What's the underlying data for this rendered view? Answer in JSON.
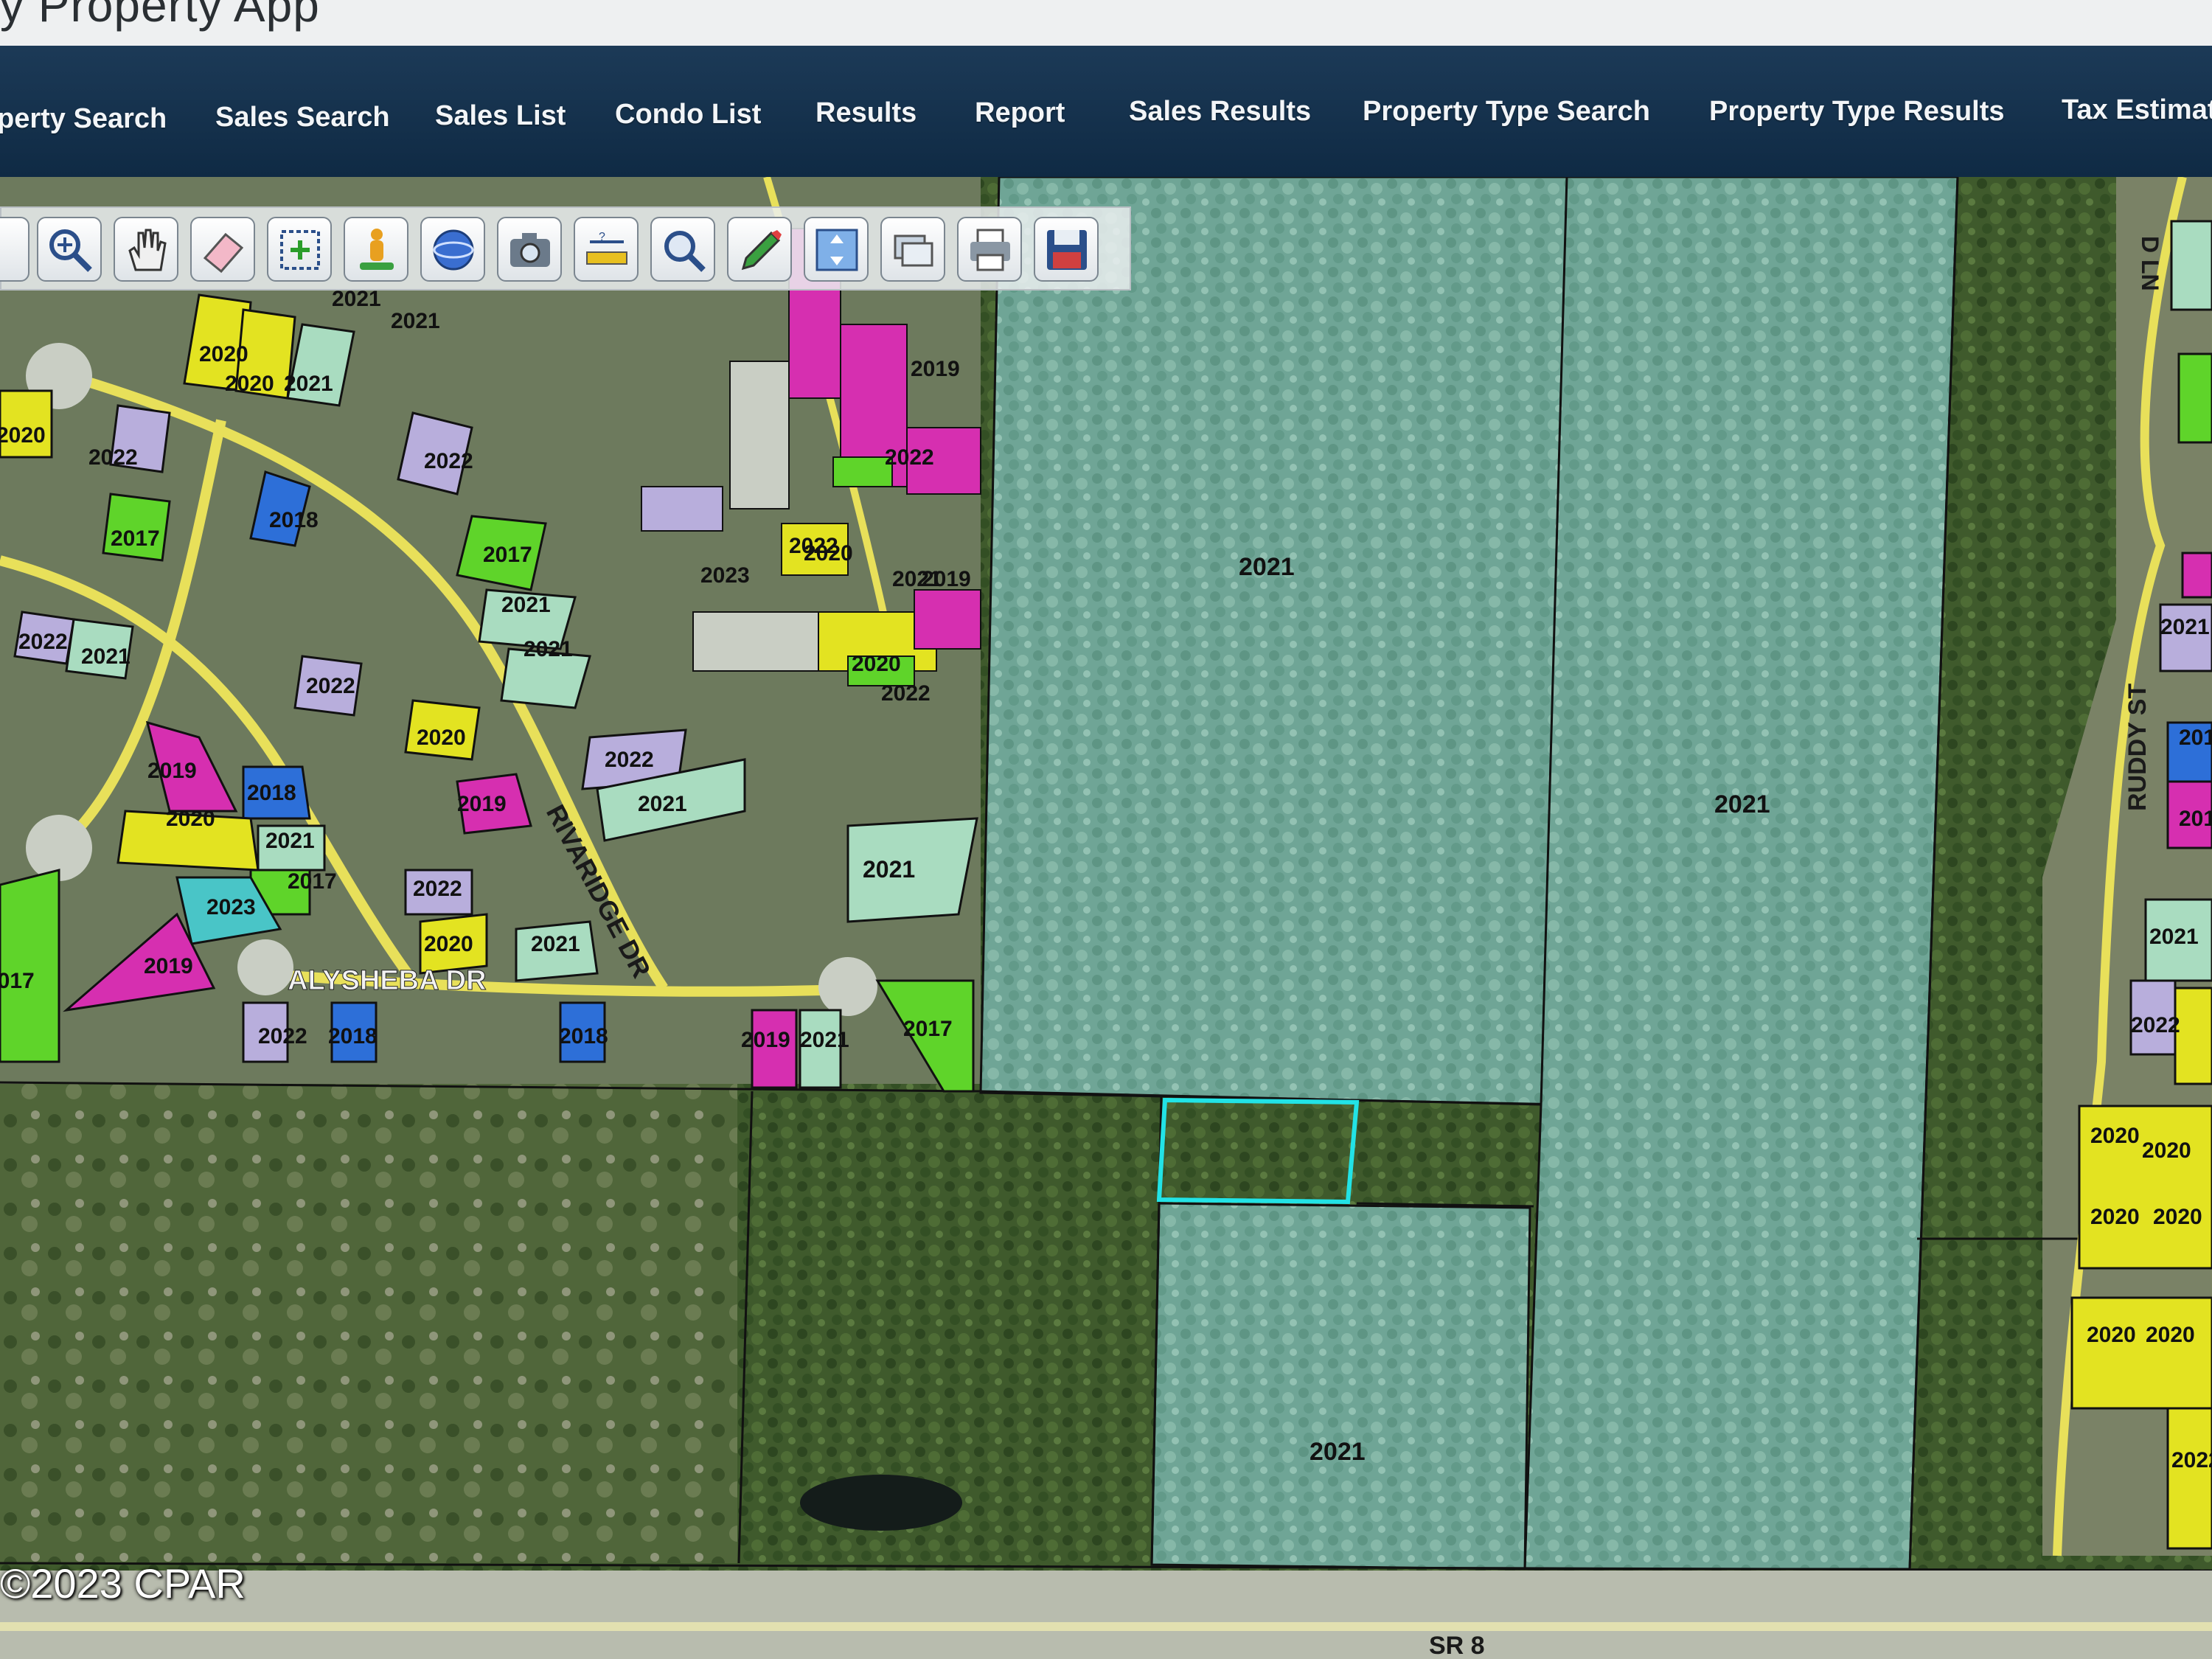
{
  "app_title": "y Property App",
  "nav": {
    "items": [
      {
        "label": "perty Search"
      },
      {
        "label": "Sales Search"
      },
      {
        "label": "Sales List"
      },
      {
        "label": "Condo List"
      },
      {
        "label": "Results"
      },
      {
        "label": "Report"
      },
      {
        "label": "Sales Results"
      },
      {
        "label": "Property Type Search"
      },
      {
        "label": "Property Type Results"
      },
      {
        "label": "Tax Estimat"
      }
    ]
  },
  "toolbar": {
    "tools": [
      "zoom-in-icon",
      "pan-hand-icon",
      "eraser-icon",
      "select-box-icon",
      "street-view-person-icon",
      "globe-icon",
      "camera-icon",
      "measure-icon",
      "search-magnifier-icon",
      "pencil-icon",
      "full-extent-icon",
      "layers-icon",
      "printer-icon",
      "save-disk-icon"
    ]
  },
  "map": {
    "streets": {
      "rivaridge": "RIVARIDGE DR",
      "alysheba": "ALYSHEBA DR",
      "ruddy": "RUDDY ST",
      "ln": "D LN",
      "sr8": "SR 8"
    },
    "large_parcels": {
      "north_center": "2021",
      "east_tall": "2021",
      "south_small": "2021",
      "east_subdivision_mid": "2021"
    },
    "sub_labels": {
      "a1": "2021",
      "a2": "2021",
      "a3": "2020",
      "a4": "2020",
      "a5": "2021",
      "a6": "2020",
      "a7": "2022",
      "a8": "2022",
      "a9": "2018",
      "a10": "2017",
      "a11": "2017",
      "a12": "2021",
      "a13": "2021",
      "a14": "2022",
      "a15": "2021",
      "a16": "2022",
      "a17": "2020",
      "a18": "2019",
      "a19": "2020",
      "a20": "2018",
      "a21": "2021",
      "a22": "2017",
      "a23": "2023",
      "a24": "2019",
      "a25": "2022",
      "a26": "2021",
      "a27": "2022",
      "a28": "2020",
      "a29": "2021",
      "a30": "2019",
      "a31": "2017",
      "a32": "2022",
      "a33": "2018",
      "a34": "2019",
      "a35": "2021",
      "a36": "2017",
      "a37": "2018",
      "a38": "2019",
      "a39": "2022",
      "a40": "2021",
      "a41": "2023",
      "a42": "2020",
      "a43": "2019",
      "a44": "2022",
      "a45": "2020",
      "a46": "2022",
      "a47": "2021",
      "a48": "2018",
      "a49": "2019",
      "a50": "2021",
      "a51": "2022",
      "a52": "2020",
      "a53": "2020",
      "a54": "2020",
      "a55": "2020",
      "a56": "2020",
      "a57": "2020",
      "a58": "2022"
    },
    "copyright": "©2023 CPAR"
  },
  "colors": {
    "nav_bg": "#16344f",
    "selected_outline": "#22e3e6",
    "parcel_yellow": "#e3e321",
    "parcel_green": "#5fd42a",
    "parcel_magenta": "#d62fb0",
    "parcel_blue": "#2d6fd8",
    "parcel_lavender": "#b8aedc",
    "parcel_mint": "#a9dcc0",
    "parcel_teal": "#49c5c7"
  }
}
